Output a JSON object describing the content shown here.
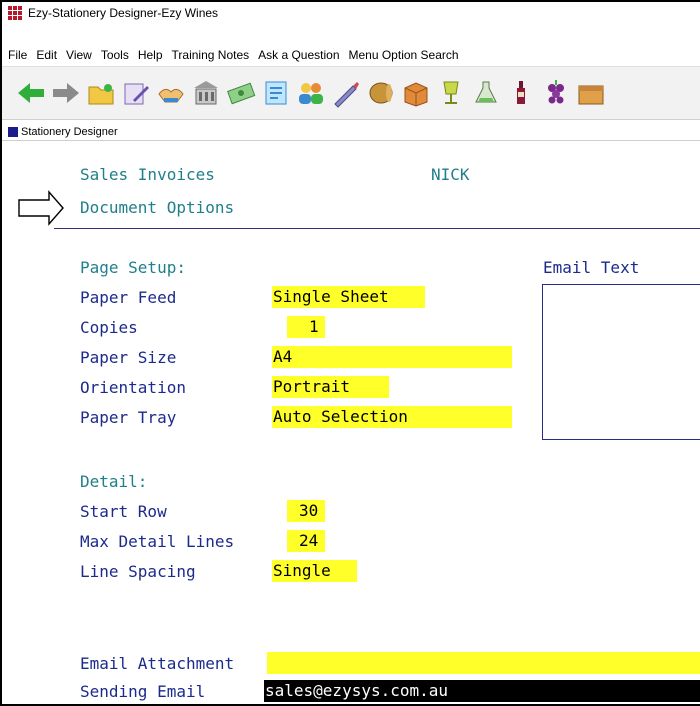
{
  "window": {
    "title": "Ezy-Stationery Designer-Ezy Wines"
  },
  "menu": [
    "File",
    "Edit",
    "View",
    "Tools",
    "Help",
    "Training Notes",
    "Ask a Question",
    "Menu Option Search"
  ],
  "toolbar": {
    "icons": [
      "back-arrow-icon",
      "forward-arrow-icon",
      "folder-icon",
      "edit-icon",
      "handshake-icon",
      "building-icon",
      "money-icon",
      "receipt-icon",
      "people-icon",
      "pen-icon",
      "barrel-icon",
      "box-icon",
      "glass-icon",
      "flask-icon",
      "bottle-icon",
      "grapes-icon",
      "package-icon"
    ]
  },
  "inner_window": {
    "caption": "Stationery Designer"
  },
  "header": {
    "document_type": "Sales Invoices",
    "user": "NICK",
    "section": "Document Options"
  },
  "page_setup": {
    "heading": "Page Setup:",
    "paper_feed": {
      "label": "Paper Feed",
      "value": "Single Sheet"
    },
    "copies": {
      "label": "Copies",
      "value": "1"
    },
    "paper_size": {
      "label": "Paper Size",
      "value": "A4"
    },
    "orientation": {
      "label": "Orientation",
      "value": "Portrait"
    },
    "paper_tray": {
      "label": "Paper Tray",
      "value": "Auto Selection"
    }
  },
  "email_text": {
    "label": "Email Text"
  },
  "detail": {
    "heading": "Detail:",
    "start_row": {
      "label": "Start Row",
      "value": "30"
    },
    "max_detail_lines": {
      "label": "Max Detail Lines",
      "value": "24"
    },
    "line_spacing": {
      "label": "Line Spacing",
      "value": "Single"
    }
  },
  "email": {
    "attachment": {
      "label": "Email Attachment",
      "value": ""
    },
    "sending": {
      "label": "Sending Email",
      "value": "sales@ezysys.com.au"
    }
  }
}
